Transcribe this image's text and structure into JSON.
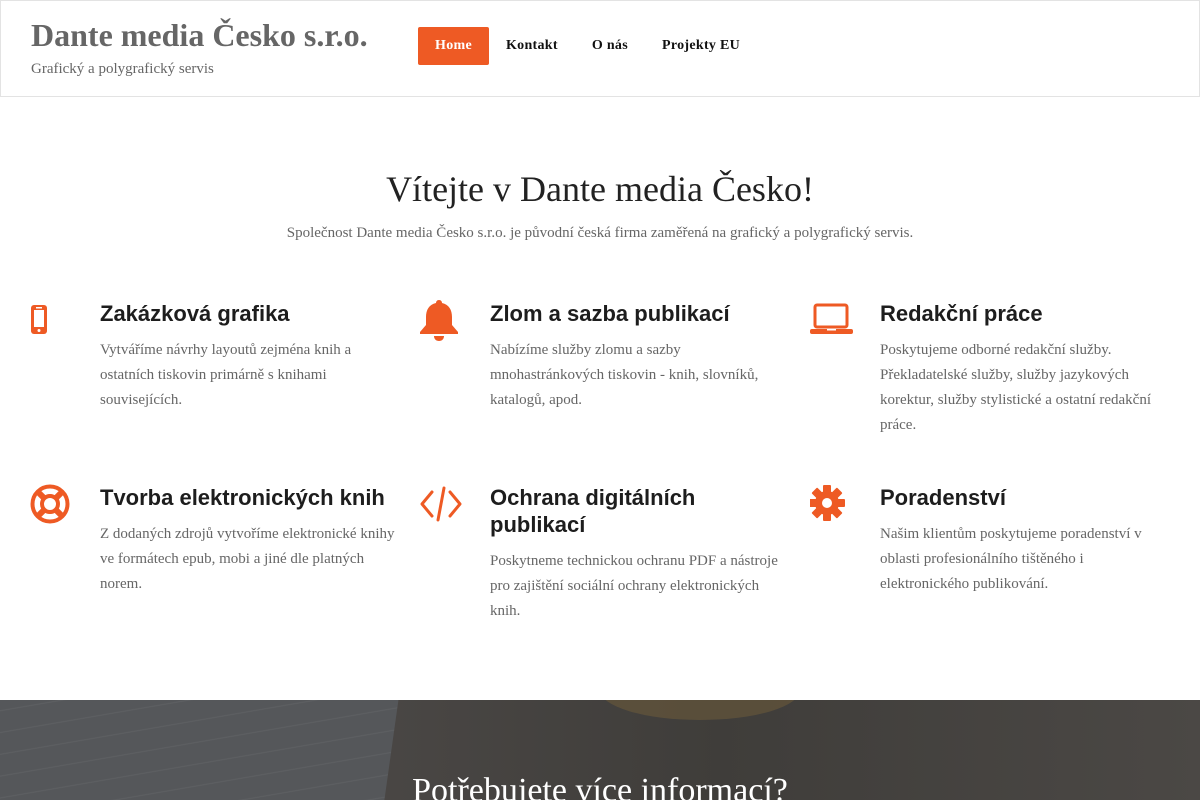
{
  "header": {
    "brand_title": "Dante media Česko s.r.o.",
    "tagline": "Grafický a polygrafický servis",
    "nav": [
      {
        "label": "Home",
        "active": true
      },
      {
        "label": "Kontakt",
        "active": false
      },
      {
        "label": "O nás",
        "active": false
      },
      {
        "label": "Projekty EU",
        "active": false
      }
    ]
  },
  "hero": {
    "title": "Vítejte v Dante media Česko!",
    "subtitle": "Společnost Dante media Česko s.r.o. je původní česká firma zaměřená na grafický a polygrafický servis."
  },
  "features": [
    {
      "icon": "mobile-icon",
      "title": "Zakázková grafika",
      "text": "Vytváříme návrhy layoutů zejména knih a ostatních tiskovin primárně s knihami souvisejících."
    },
    {
      "icon": "bell-icon",
      "title": "Zlom a sazba publikací",
      "text": "Nabízíme služby zlomu a sazby mnohastránkových tiskovin - knih, slovníků, katalogů, apod."
    },
    {
      "icon": "laptop-icon",
      "title": "Redakční práce",
      "text": "Poskytujeme odborné redakční služby. Překladatelské služby, služby jazykových korektur, služby stylistické a ostatní redakční práce."
    },
    {
      "icon": "lifebuoy-icon",
      "title": "Tvorba elektronických knih",
      "text": "Z dodaných zdrojů vytvoříme elektronické knihy ve formátech epub, mobi a jiné dle platných norem."
    },
    {
      "icon": "code-icon",
      "title": "Ochrana digitálních publikací",
      "text": "Poskytneme technickou ochranu PDF a nástroje pro zajištění sociální ochrany elektronických knih."
    },
    {
      "icon": "gear-icon",
      "title": "Poradenství",
      "text": "Našim klientům poskytujeme poradenství v oblasti profesionálního tištěného i elektronického publikování."
    }
  ],
  "banner": {
    "title": "Potřebujete více informací?"
  },
  "colors": {
    "accent": "#ee5a24",
    "text_muted": "#666666",
    "heading": "#1d1d1d"
  }
}
